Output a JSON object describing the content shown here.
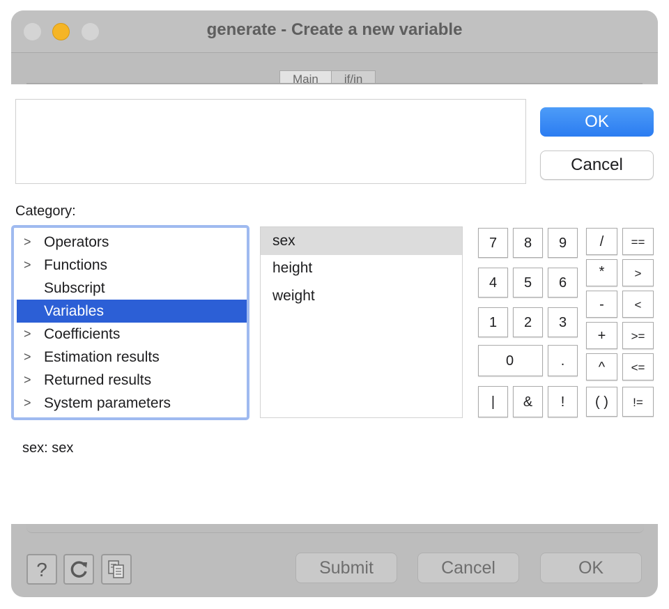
{
  "window": {
    "title": "generate - Create a new variable",
    "tabs": [
      "Main",
      "if/in"
    ]
  },
  "dialog": {
    "ok_label": "OK",
    "cancel_label": "Cancel",
    "expression_value": "",
    "category_label": "Category:",
    "categories": [
      {
        "label": "Operators",
        "expandable": true,
        "selected": false
      },
      {
        "label": "Functions",
        "expandable": true,
        "selected": false
      },
      {
        "label": "Subscript",
        "expandable": false,
        "selected": false
      },
      {
        "label": "Variables",
        "expandable": false,
        "selected": true
      },
      {
        "label": "Coefficients",
        "expandable": true,
        "selected": false
      },
      {
        "label": "Estimation results",
        "expandable": true,
        "selected": false
      },
      {
        "label": "Returned results",
        "expandable": true,
        "selected": false
      },
      {
        "label": "System parameters",
        "expandable": true,
        "selected": false
      }
    ],
    "variables": [
      {
        "label": "sex",
        "selected": true
      },
      {
        "label": "height",
        "selected": false
      },
      {
        "label": "weight",
        "selected": false
      }
    ],
    "keypad": {
      "n7": "7",
      "n8": "8",
      "n9": "9",
      "n4": "4",
      "n5": "5",
      "n6": "6",
      "n1": "1",
      "n2": "2",
      "n3": "3",
      "n0": "0",
      "dot": ".",
      "pipe": "|",
      "amp": "&",
      "bang": "!",
      "div": "/",
      "mul": "*",
      "minus": "-",
      "plus": "+",
      "pow": "^",
      "paren": "( )",
      "eq": "==",
      "gt": ">",
      "lt": "<",
      "ge": ">=",
      "le": "<=",
      "ne": "!="
    },
    "description": "sex:  sex"
  },
  "footer": {
    "help_icon": "question-mark-icon",
    "reset_icon": "refresh-icon",
    "copy_icon": "copy-command-icon",
    "submit_label": "Submit",
    "cancel_label": "Cancel",
    "ok_label": "OK"
  },
  "colors": {
    "accent": "#2b7cf1",
    "selection": "#2c5fd6",
    "focus_ring": "#9fbaf0",
    "window_minimize": "#f5b526"
  }
}
